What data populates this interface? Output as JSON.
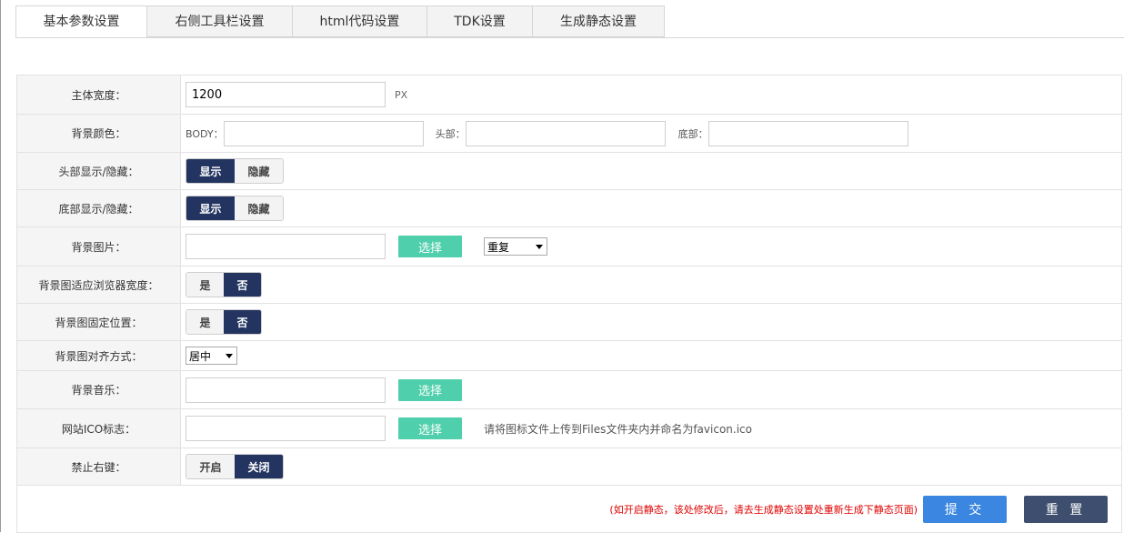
{
  "tabs": [
    {
      "label": "基本参数设置",
      "active": true
    },
    {
      "label": "右侧工具栏设置",
      "active": false
    },
    {
      "label": "html代码设置",
      "active": false
    },
    {
      "label": "TDK设置",
      "active": false
    },
    {
      "label": "生成静态设置",
      "active": false
    }
  ],
  "form": {
    "body_width": {
      "label": "主体宽度：",
      "value": "1200",
      "unit": "PX"
    },
    "bg_color": {
      "label": "背景颜色：",
      "body_label": "BODY：",
      "header_label": "头部：",
      "footer_label": "底部：",
      "body_value": "",
      "header_value": "",
      "footer_value": ""
    },
    "header_display": {
      "label": "头部显示/隐藏：",
      "show": "显示",
      "hide": "隐藏",
      "selected": "显示"
    },
    "footer_display": {
      "label": "底部显示/隐藏：",
      "show": "显示",
      "hide": "隐藏",
      "selected": "显示"
    },
    "bg_image": {
      "label": "背景图片：",
      "value": "",
      "choose": "选择",
      "repeat_selected": "重复"
    },
    "bg_fit": {
      "label": "背景图适应浏览器宽度：",
      "yes": "是",
      "no": "否",
      "selected": "否"
    },
    "bg_fixed": {
      "label": "背景图固定位置：",
      "yes": "是",
      "no": "否",
      "selected": "否"
    },
    "bg_align": {
      "label": "背景图对齐方式：",
      "selected": "居中"
    },
    "bg_music": {
      "label": "背景音乐：",
      "value": "",
      "choose": "选择"
    },
    "favicon": {
      "label": "网站ICO标志：",
      "value": "",
      "choose": "选择",
      "hint": "请将图标文件上传到Files文件夹内并命名为favicon.ico"
    },
    "disable_right_click": {
      "label": "禁止右键：",
      "on": "开启",
      "off": "关闭",
      "selected": "关闭"
    }
  },
  "footer": {
    "warning": "(如开启静态，该处修改后，请去生成静态设置处重新生成下静态页面)",
    "submit": "提 交",
    "reset": "重 置"
  },
  "colors": {
    "toggle_active": "#233460",
    "choose_button": "#4fcfab",
    "submit_button": "#3a86e0",
    "reset_button": "#3d4e6e",
    "warning_text": "#e00000"
  }
}
